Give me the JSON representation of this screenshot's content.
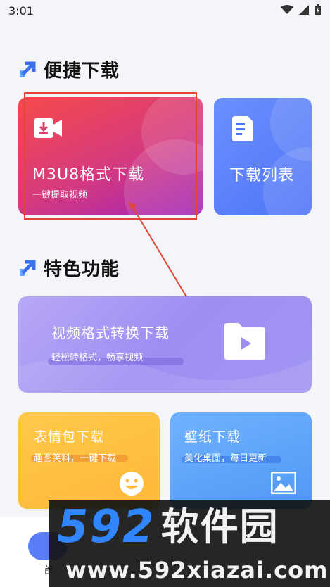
{
  "status_bar": {
    "time": "3:01"
  },
  "sections": {
    "quick_download": "便捷下载",
    "features": "特色功能"
  },
  "cards": {
    "m3u8": {
      "title": "M3U8格式下载",
      "subtitle": "一键提取视频"
    },
    "download_list": {
      "title": "下载列表"
    },
    "convert": {
      "title": "视频格式转换下载",
      "subtitle": "轻松转格式，畅享视频"
    },
    "emoji": {
      "title": "表情包下载",
      "subtitle": "趣图笑料，一键下载"
    },
    "wallpaper": {
      "title": "壁纸下载",
      "subtitle": "美化桌面，每日更新"
    }
  },
  "bottom_nav": {
    "home_label": "首"
  },
  "watermark": {
    "digits": "592",
    "name": "软件园",
    "url": "www.592xiazai.com"
  },
  "colors": {
    "accent": "#4e74f6",
    "annotation": "#e0453a"
  },
  "icons": [
    "wifi-icon",
    "signal-icon",
    "battery-icon",
    "download-video-icon",
    "document-list-icon",
    "folder-play-icon",
    "smiley-icon",
    "image-icon",
    "arrow-up-right-icon"
  ]
}
